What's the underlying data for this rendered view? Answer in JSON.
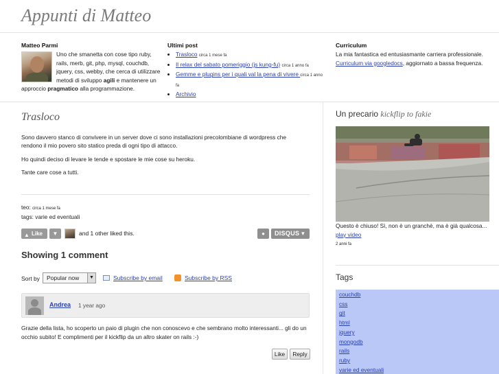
{
  "site": {
    "title": "Appunti di Matteo"
  },
  "bio": {
    "name": "Matteo Parmi",
    "text_1": "Uno che smanetta con cose tipo ruby, rails, merb, git, php, mysql, couchdb, jquery, css, webby, che cerca di utilizzare metodi di sviluppo ",
    "agili": "agili",
    "text_2": " e mantenere un approccio ",
    "pragmatico": "pragmatico",
    "text_3": " alla programmazione."
  },
  "posts": {
    "heading": "Ultimi post",
    "items": [
      {
        "label": "Trasloco",
        "age": "circa 1 mese fa"
      },
      {
        "label": "Il relax del sabato pomeriggio (js kung-fu)",
        "age": "circa 1 anno fa"
      },
      {
        "label": "Gemme e plugins per i quali val la pena di vivere ",
        "age": "circa 1 anno fa"
      }
    ],
    "archive": "Archivio"
  },
  "curriculum": {
    "heading": "Curriculum",
    "text_1": "La mia fantastica ed entusiasmante carriera professionale. ",
    "link": "Curriculum via googledocs",
    "text_2": ", aggiornato a bassa frequenza."
  },
  "post": {
    "title": "Trasloco",
    "p1": "Sono davvero stanco di convivere in un server dove ci sono installazioni precolombiane di wordpress che rendono il mio povero sito statico preda di ogni tipo di attacco.",
    "p2": "Ho quindi deciso di levare le tende e spostare le mie cose su heroku.",
    "p3": "Tante care cose a tutti.",
    "author": "teo:",
    "age": "circa 1 mese fa",
    "tags": "tags: varie ed eventuali"
  },
  "disqus": {
    "like": "Like",
    "liked_text": "and 1 other liked this.",
    "logo": "DISQUS",
    "comments_count": "Showing 1 comment",
    "sort_by": "Sort by",
    "sort_value": "Popular now",
    "subscribe_email": "Subscribe by email",
    "subscribe_rss": "Subscribe by RSS",
    "comment": {
      "author": "Andrea",
      "time": "1 year ago",
      "text": "Grazie della lista, ho scoperto un paio di plugin che non conoscevo e che sembrano molto interessanti... gli do un occhio subito! E complimenti per il kickflip da un altro skater on rails :-)",
      "like": "Like",
      "reply": "Reply"
    }
  },
  "sidebar": {
    "title_1": "Un precario ",
    "title_2": "kickflip to fakie",
    "caption_1": "Questo è chiuso! Sì, non è un granchè, ma è già qualcosa... ",
    "caption_link": "play video",
    "caption_age": "2 anni fa",
    "tags_title": "Tags",
    "tags": [
      "couchdb",
      "css",
      "git",
      "html",
      "jquery",
      "mongodb",
      "rails",
      "ruby",
      "varie ed eventuali"
    ]
  },
  "colors": {
    "link": "#2a3fb0",
    "tags_bg": "#b9c8f7",
    "title_grey": "#7a7a7a"
  }
}
